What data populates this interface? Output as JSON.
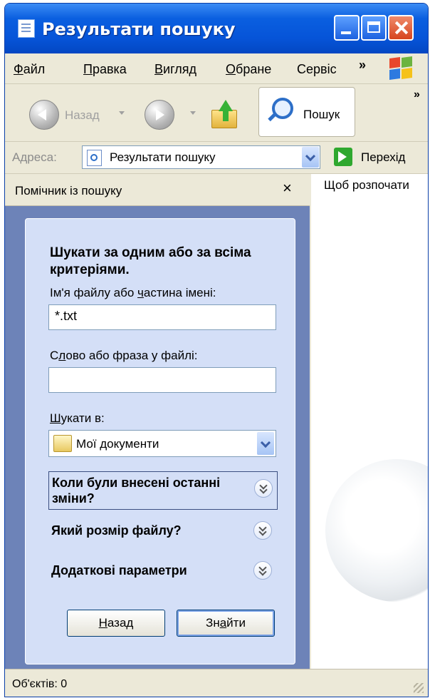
{
  "window": {
    "title": "Результати пошуку"
  },
  "menu": {
    "items": [
      "Файл",
      "Правка",
      "Вигляд",
      "Обране",
      "Сервіс"
    ],
    "more": "»"
  },
  "toolbar": {
    "back_label": "Назад",
    "search_label": "Пошук",
    "more": "»"
  },
  "address": {
    "label": "Адреса:",
    "value": "Результати пошуку",
    "go_label": "Перехід"
  },
  "pane": {
    "title": "Помічник із пошуку",
    "close": "×",
    "heading": "Шукати за одним або за всіма критеріями.",
    "filename_label": "Ім'я файлу або частина імені:",
    "filename_value": "*.txt",
    "phrase_label": "Слово або фраза у файлі:",
    "phrase_value": "",
    "lookin_label": "Шукати в:",
    "lookin_value": "Мої документи",
    "expanders": [
      "Коли були внесені останні зміни?",
      "Який розмір файлу?",
      "Додаткові параметри"
    ],
    "back_button": "Назад",
    "find_button": "Знайти"
  },
  "results": {
    "hint": "Щоб розпочати"
  },
  "status": {
    "text": "Об'єктів: 0"
  }
}
